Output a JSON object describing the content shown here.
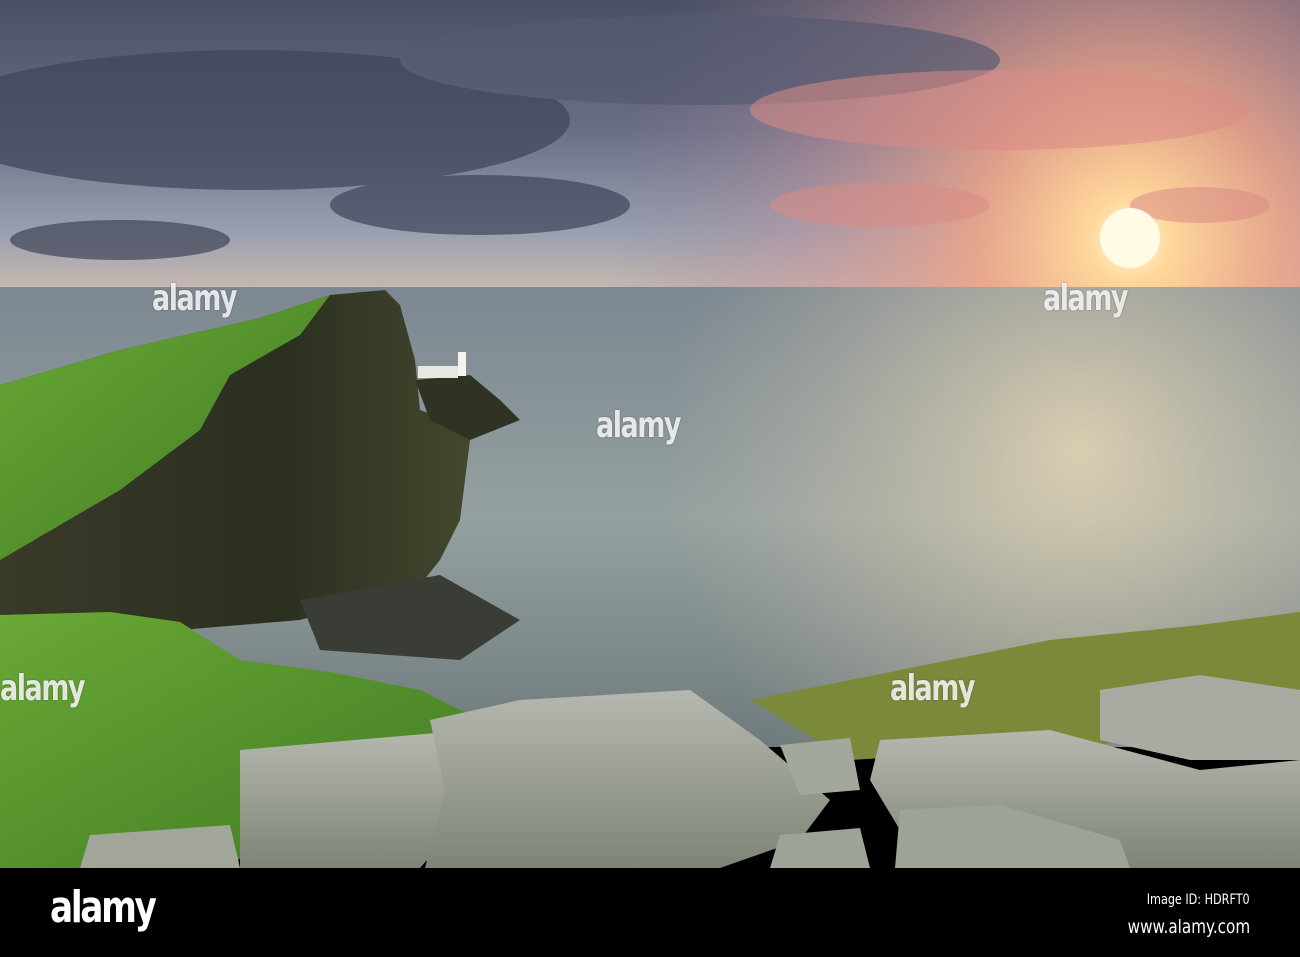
{
  "watermark": {
    "logo": "alamy",
    "image_id": "Image ID: HDRFT0",
    "website": "www.alamy.com",
    "overlay_text": "alamy"
  },
  "scene": {
    "description_tags": [
      "sea-cliff",
      "lighthouse",
      "sunset",
      "ocean",
      "rocks",
      "grass"
    ],
    "colors": {
      "sky_dark": "#4b5266",
      "sun": "#fff6c8",
      "sea": "#8f9a9c",
      "grass": "#5e9a2c",
      "cliff": "#2e3222",
      "rock": "#9aa095"
    }
  }
}
